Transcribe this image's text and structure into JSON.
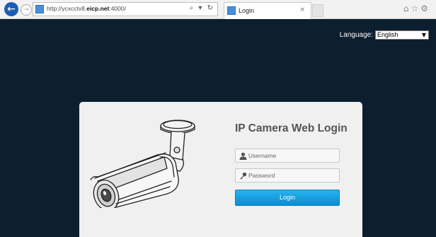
{
  "browser": {
    "url_prefix": "http://ycxcctv8.",
    "url_domain": "eicp.net",
    "url_suffix": ":4000/",
    "address_buttons": "⌕ ▾ ↻",
    "tab_title": "Login",
    "tab_close": "×",
    "back_icon": "←",
    "forward_icon": "→",
    "toolbar_icons": "⌂☆⚙"
  },
  "page": {
    "language_label": "Language:",
    "language_selected": "English",
    "title": "IP Camera Web Login",
    "username_placeholder": "Username",
    "password_placeholder": "Password",
    "login_label": "Login"
  },
  "colors": {
    "page_background": "#0d1e2f",
    "card_background": "#f0f0f0",
    "button_blue": "#1aa2e3",
    "back_button": "#1e5fb4"
  }
}
